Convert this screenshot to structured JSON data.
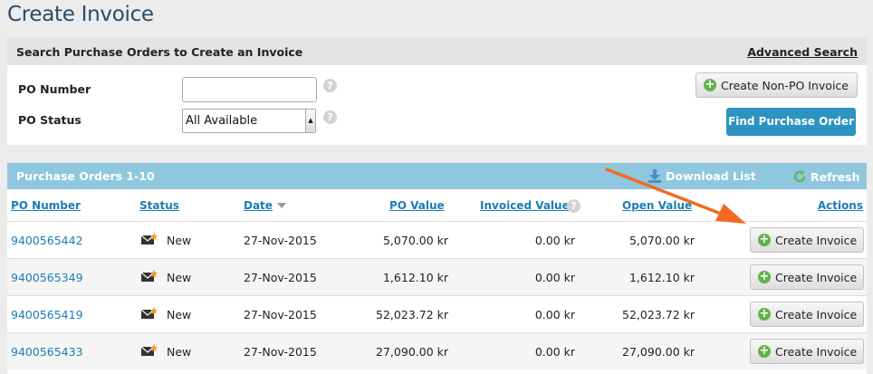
{
  "page": {
    "title": "Create Invoice"
  },
  "search": {
    "header": "Search Purchase Orders to Create an Invoice",
    "advanced_link": "Advanced Search",
    "po_number_label": "PO Number",
    "po_number_value": "",
    "po_status_label": "PO Status",
    "po_status_selected": "All Available",
    "help_glyph": "?",
    "create_non_po_label": "Create Non-PO Invoice",
    "find_po_label": "Find Purchase Order"
  },
  "orders": {
    "header": "Purchase Orders 1-10",
    "download_label": "Download List",
    "refresh_label": "Refresh",
    "columns": {
      "po_number": "PO Number",
      "status": "Status",
      "date": "Date",
      "po_value": "PO Value",
      "invoiced_value": "Invoiced Value",
      "open_value": "Open Value",
      "actions": "Actions"
    },
    "rows": [
      {
        "po_number": "9400565442",
        "status": "New",
        "date": "27-Nov-2015",
        "po_value": "5,070.00 kr",
        "invoiced_value": "0.00 kr",
        "open_value": "5,070.00 kr",
        "action": "Create Invoice"
      },
      {
        "po_number": "9400565349",
        "status": "New",
        "date": "27-Nov-2015",
        "po_value": "1,612.10 kr",
        "invoiced_value": "0.00 kr",
        "open_value": "1,612.10 kr",
        "action": "Create Invoice"
      },
      {
        "po_number": "9400565419",
        "status": "New",
        "date": "27-Nov-2015",
        "po_value": "52,023.72 kr",
        "invoiced_value": "0.00 kr",
        "open_value": "52,023.72 kr",
        "action": "Create Invoice"
      },
      {
        "po_number": "9400565433",
        "status": "New",
        "date": "27-Nov-2015",
        "po_value": "27,090.00 kr",
        "invoiced_value": "0.00 kr",
        "open_value": "27,090.00 kr",
        "action": "Create Invoice"
      }
    ]
  },
  "colors": {
    "title": "#2c4a66",
    "link": "#1b7db4",
    "primary_button": "#2d93c1",
    "orders_header": "#8ec7de",
    "plus_icon": "#62b24a",
    "annotation_arrow": "#f26a21"
  },
  "icons": {
    "plus": "plus-circle-icon",
    "help": "help-icon",
    "download": "download-icon",
    "refresh": "refresh-icon",
    "status_new": "new-envelope-icon",
    "sort": "sort-descending-icon"
  }
}
